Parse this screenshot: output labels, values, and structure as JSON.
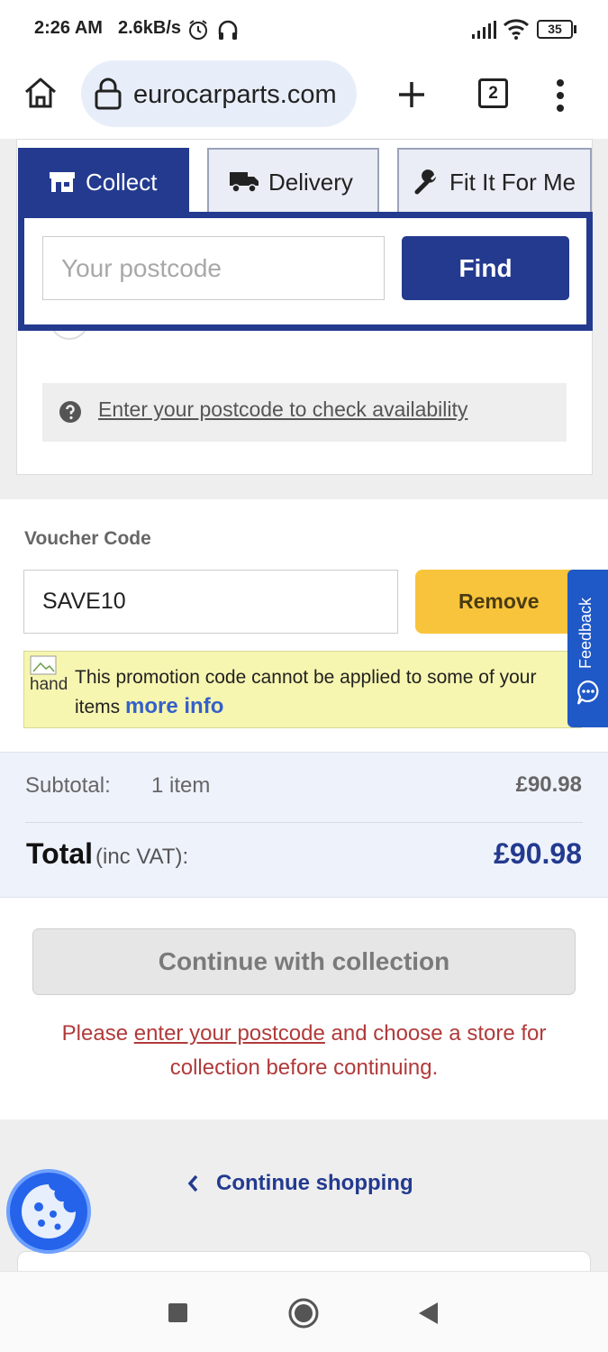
{
  "status_bar": {
    "time": "2:26 AM",
    "speed": "2.6kB/s",
    "icons": [
      "alarm-icon",
      "headphones-icon",
      "signal-icon",
      "wifi-icon"
    ],
    "battery": "35"
  },
  "browser": {
    "url": "eurocarparts.com",
    "tab_count": "2",
    "icons": [
      "home-icon",
      "lock-icon",
      "new-tab-icon",
      "tabs-icon",
      "menu-icon"
    ]
  },
  "collect_card": {
    "tabs": [
      {
        "label": "Collect",
        "icon": "store-icon",
        "selected": true
      },
      {
        "label": "Delivery",
        "icon": "truck-icon",
        "selected": false
      },
      {
        "label": "Fit It For Me",
        "icon": "wrench-icon",
        "selected": false
      }
    ],
    "postcode_placeholder": "Your postcode",
    "find_label": "Find",
    "availability_text": "Enter your postcode to check availability"
  },
  "voucher": {
    "label": "Voucher Code",
    "value": "SAVE10",
    "remove_label": "Remove",
    "promo_image_alt": "hand",
    "promo_text": "This promotion code cannot be applied to some of your items",
    "promo_link": "more info"
  },
  "feedback": {
    "label": "Feedback"
  },
  "totals": {
    "subtotal_label": "Subtotal:",
    "subtotal_count": "1 item",
    "subtotal_value": "£90.98",
    "total_label": "Total",
    "total_vat": "(inc VAT):",
    "total_value": "£90.98"
  },
  "checkout": {
    "continue_label": "Continue with collection",
    "warning_before": "Please ",
    "warning_link": "enter your postcode",
    "warning_after": " and choose a store for collection before continuing."
  },
  "footer": {
    "continue_shopping": "Continue shopping"
  },
  "colors": {
    "brand_blue": "#233a8f",
    "accent_yellow": "#f8c43b",
    "warning_red": "#b13a3a",
    "feedback_blue": "#1f58c7"
  }
}
